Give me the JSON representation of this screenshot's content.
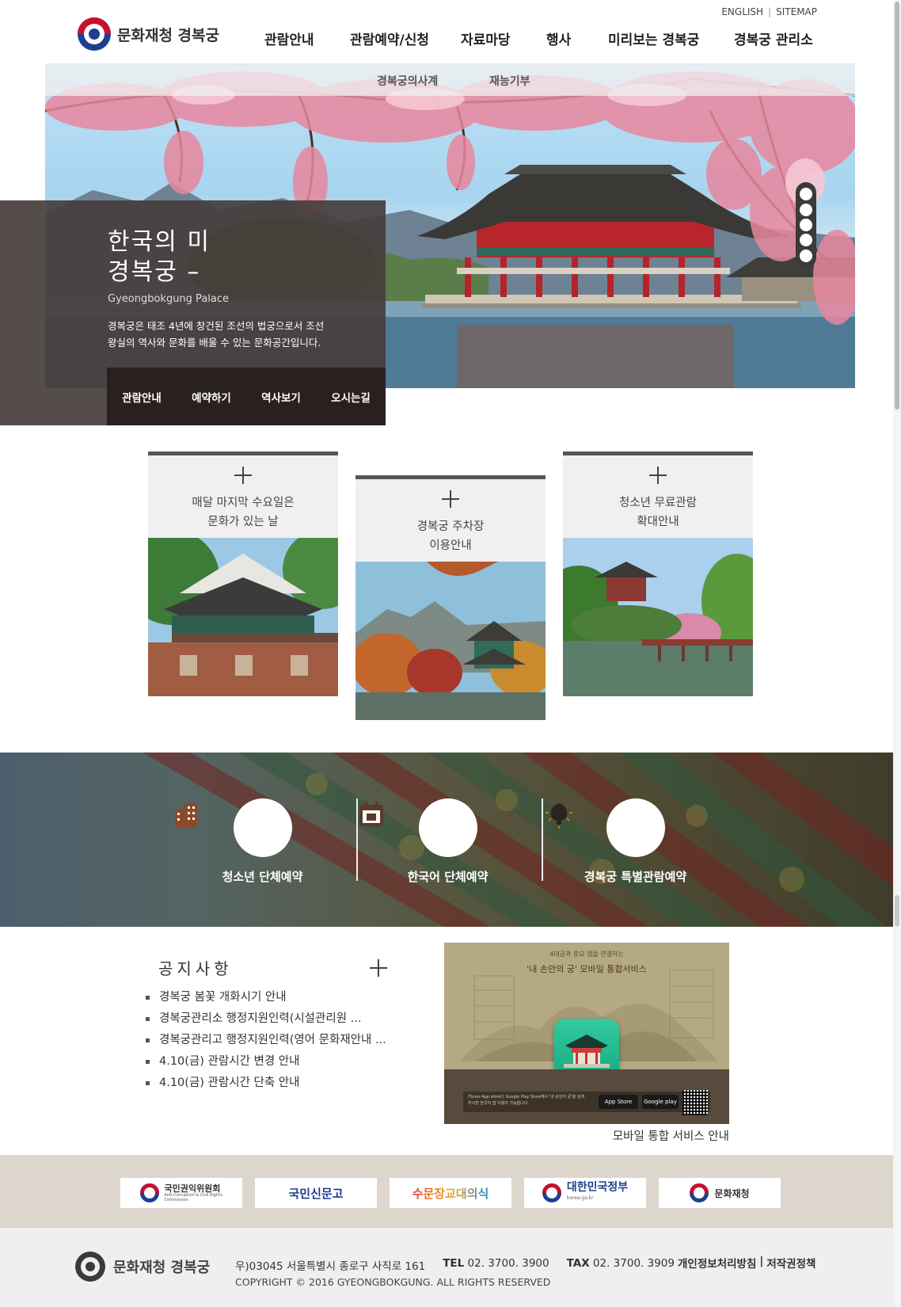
{
  "header": {
    "util_links": [
      "ENGLISH",
      "SITEMAP"
    ],
    "logo_text": "문화재청 경복궁",
    "nav": [
      "관람안내",
      "관람예약/신청",
      "자료마당",
      "행사",
      "미리보는 경복궁",
      "경복궁 관리소"
    ]
  },
  "subnav": [
    "경복궁의사계",
    "재능기부"
  ],
  "hero": {
    "title_line1": "한국의 미",
    "title_line2": "경복궁  –",
    "subtitle": "Gyeongbokgung Palace",
    "desc_line1": "경복궁은 태조 4년에 창건된 조선의 법궁으로서 조선",
    "desc_line2": "왕실의 역사와 문화를 배울 수 있는 문화공간입니다.",
    "tabs": [
      "관람안내",
      "예약하기",
      "역사보기",
      "오시는길"
    ],
    "slides": 5
  },
  "cards": [
    {
      "line1": "매달 마지막 수요일은",
      "line2": "문화가 있는 날"
    },
    {
      "line1": "경복궁 주차장",
      "line2": "이용안내"
    },
    {
      "line1": "청소년 무료관람",
      "line2": "확대안내"
    }
  ],
  "reservations": [
    {
      "label": "청소년 단체예약",
      "icon": "building-icon"
    },
    {
      "label": "한국어 단체예약",
      "icon": "calendar-icon"
    },
    {
      "label": "경복궁 특별관람예약",
      "icon": "lamp-icon"
    }
  ],
  "notice": {
    "title": "공지사항",
    "items": [
      "경복궁 봄꽃 개화시기 안내",
      "경복궁관리소 행정지원인력(시설관리원 ...",
      "경복궁관리고 행정지원인력(영어 문화재안내 ...",
      "4.10(금) 관람시간 변경 안내",
      "4.10(금) 관람시간 단축 안내"
    ]
  },
  "banner": {
    "small_top": "4대궁과 종묘 앱을 연결하는",
    "headline": "'내 손안의 궁' 모바일 통합서비스",
    "fine_print": "iTunes App store나 Google Play Store에서 '내 손안의 궁'을 검색하시면 한국어 앱 이용이 가능합니다.",
    "app_store": "App Store",
    "google_play": "Google play",
    "caption": "모바일 통합 서비스 안내"
  },
  "partners": [
    {
      "name": "국민권익위원회",
      "sub": "Anti-Corruption & Civil Rights Commission"
    },
    {
      "name": "국민신문고"
    },
    {
      "name": "수문장교대의식"
    },
    {
      "name": "대한민국정부",
      "sub": "korea.go.kr"
    },
    {
      "name": "문화재청"
    }
  ],
  "footer": {
    "logo_text": "문화재청 경복궁",
    "address": "우)03045 서울특별시 종로구 사직로 161",
    "tel_label": "TEL",
    "tel": "02. 3700. 3900",
    "tax_label": "TAX",
    "tax": "02. 3700. 3909",
    "copyright": "COPYRIGHT © 2016 GYEONGBOKGUNG. ALL RIGHTS RESERVED",
    "link_privacy": "개인정보처리방침",
    "link_sep": "|",
    "link_copyright": "저작권정책"
  },
  "colors": {
    "nav_text": "#222222",
    "hero_panel": "#463e3c",
    "hero_tabs": "#2a2020",
    "card_border": "#555555",
    "partners_bg": "#ddd6cc",
    "footer_bg": "#efefef"
  }
}
